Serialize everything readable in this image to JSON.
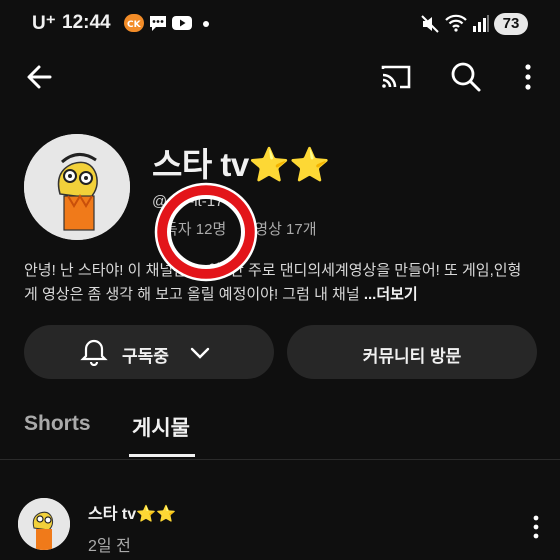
{
  "status_bar": {
    "carrier": "U⁺",
    "time": "12:44",
    "battery": "73",
    "app_icons": [
      "chat-app-icon",
      "messages-icon",
      "youtube-icon"
    ]
  },
  "top_bar": {
    "icons": [
      "back-arrow-icon",
      "cast-icon",
      "search-icon",
      "more-vert-icon"
    ]
  },
  "channel": {
    "name": "스타 tv",
    "stars": "⭐⭐",
    "handle": "@",
    "handle_suffix": "-it-17",
    "subscribers": "독자 12명",
    "videos": "영상 17개",
    "description": "안녕! 난 스타야! 이 채널은 ... 야! 난 주로 댄디의세계영상을 만들어! 또 게임,인형게 영상은 좀 생각 해 보고 올릴 예정이야! 그럼 내 채널",
    "more_label": "...더보기"
  },
  "buttons": {
    "subscribed": "구독중",
    "community": "커뮤니티 방문"
  },
  "tabs": [
    {
      "label": "Shorts",
      "active": false
    },
    {
      "label": "게시물",
      "active": true
    }
  ],
  "post": {
    "author": "스타 tv",
    "stars": "⭐⭐",
    "time_ago": "2일 전"
  },
  "colors": {
    "background": "#0f0f0f",
    "pill": "#272727",
    "annotation_ring": "#e3151a",
    "star": "#f3c623"
  }
}
